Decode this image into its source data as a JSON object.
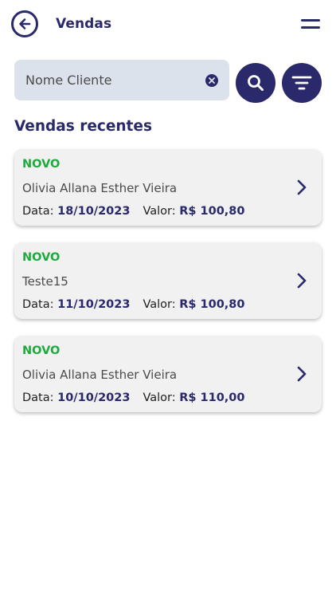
{
  "header": {
    "title": "Vendas",
    "back_icon": "arrow-left-circle-icon",
    "menu_icon": "menu-icon"
  },
  "search": {
    "placeholder": "Nome Cliente",
    "value": "",
    "clear_icon": "clear-icon",
    "search_icon": "search-icon",
    "filter_icon": "filter-icon"
  },
  "section": {
    "title": "Vendas recentes"
  },
  "sales": [
    {
      "status": "NOVO",
      "client": "Olivia Allana Esther Vieira",
      "date_label": "Data:",
      "date": "18/10/2023",
      "value_label": "Valor:",
      "value": "R$ 100,80"
    },
    {
      "status": "NOVO",
      "client": "Teste15",
      "date_label": "Data:",
      "date": "11/10/2023",
      "value_label": "Valor:",
      "value": "R$ 100,80"
    },
    {
      "status": "NOVO",
      "client": "Olivia Allana Esther Vieira",
      "date_label": "Data:",
      "date": "10/10/2023",
      "value_label": "Valor:",
      "value": "R$ 110,00"
    }
  ],
  "colors": {
    "primary": "#29296b",
    "status_new": "#1faa3f",
    "search_bg": "#dce2ec",
    "card_bg": "#f1f1f1"
  }
}
